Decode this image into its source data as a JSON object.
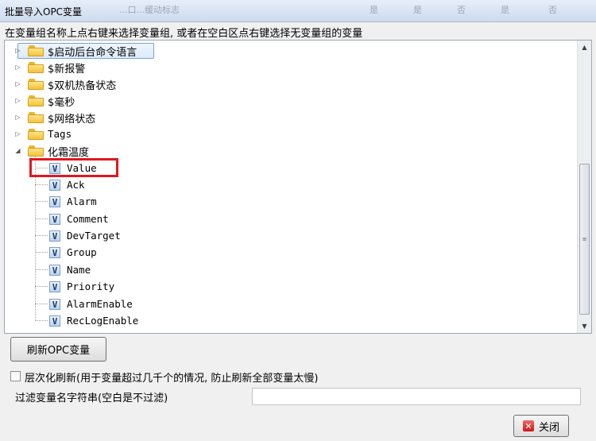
{
  "window": {
    "title": "批量导入OPC变量",
    "ghost_texts": [
      "...口...缓动标志",
      "是",
      "是",
      "否",
      "是",
      "否"
    ]
  },
  "instruction": "在变量组名称上点右键来选择变量组, 或者在空白区点右键选择无变量组的变量",
  "tree": {
    "groups": [
      {
        "label": "$启动后台命令语言",
        "expanded": false,
        "selected": true
      },
      {
        "label": "$新报警",
        "expanded": false
      },
      {
        "label": "$双机热备状态",
        "expanded": false
      },
      {
        "label": "$毫秒",
        "expanded": false
      },
      {
        "label": "$网络状态",
        "expanded": false
      },
      {
        "label": "Tags",
        "expanded": false
      },
      {
        "label": "化霜温度",
        "expanded": true
      }
    ],
    "variable_icon": "V",
    "variables": [
      "Value",
      "Ack",
      "Alarm",
      "Comment",
      "DevTarget",
      "Group",
      "Name",
      "Priority",
      "AlarmEnable",
      "RecLogEnable"
    ],
    "highlighted_variable": "Value"
  },
  "buttons": {
    "refresh_label": "刷新OPC变量",
    "close_label": "关闭"
  },
  "options": {
    "hierarchical_refresh_label": "层次化刷新(用于变量超过几千个的情况, 防止刷新全部变量太慢)",
    "hierarchical_refresh_checked": false
  },
  "filter": {
    "label": "过滤变量名字符串(空白是不过滤)",
    "value": ""
  },
  "colors": {
    "highlight_border": "#e01820",
    "selection_bg": "#dcebfc"
  }
}
